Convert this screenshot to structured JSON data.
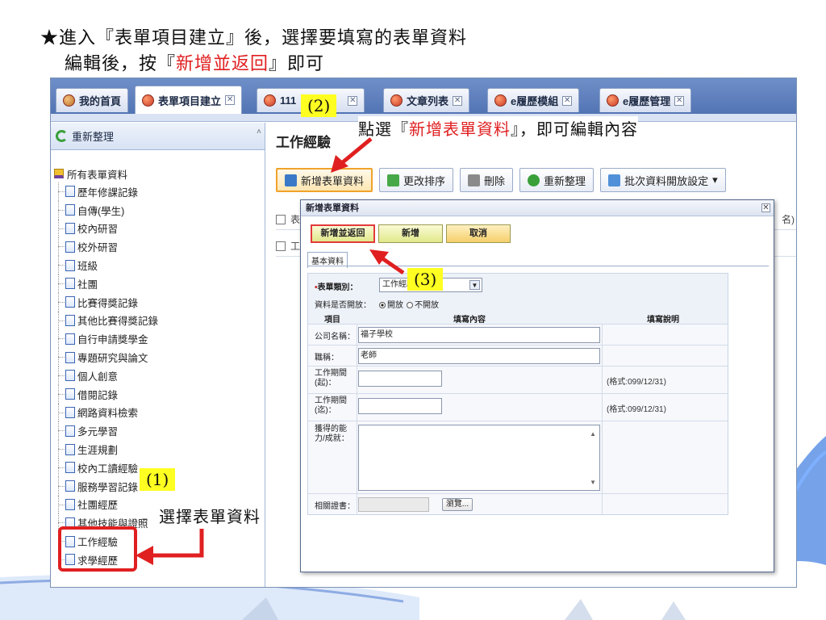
{
  "headline": {
    "line1": "★進入『表單項目建立』後，選擇要填寫的表單資料",
    "line2_prefix": "編輯後，按『",
    "line2_highlight": "新增並返回",
    "line2_suffix": "』即可"
  },
  "tabs": [
    {
      "label": "我的首頁",
      "icon": "home-icon",
      "closable": false
    },
    {
      "label": "表單項目建立",
      "icon": "app-icon",
      "closable": true
    },
    {
      "label": "111",
      "icon": "app-icon",
      "closable": true
    },
    {
      "label": "文章列表",
      "icon": "app-icon",
      "closable": true
    },
    {
      "label": "e履歷模組",
      "icon": "app-icon",
      "closable": true
    },
    {
      "label": "e履歷管理",
      "icon": "app-icon",
      "closable": true
    }
  ],
  "left_panel": {
    "refresh_label": "重新整理",
    "root_label": "所有表單資料",
    "items": [
      "歷年修課記錄",
      "自傳(學生)",
      "校內研習",
      "校外研習",
      "班級",
      "社團",
      "比賽得獎記錄",
      "其他比賽得獎記錄",
      "自行申請獎學金",
      "專題研究與論文",
      "個人創意",
      "借閱記錄",
      "網路資料檢索",
      "多元學習",
      "生涯規劃",
      "校內工讀經驗",
      "服務學習記錄",
      "社團經歷",
      "其他技能與證照",
      "工作經驗",
      "求學經歷"
    ]
  },
  "main": {
    "title": "工作經驗",
    "toolbar": {
      "add": "新增表單資料",
      "sort": "更改排序",
      "delete": "刪除",
      "refresh": "重新整理",
      "batch": "批次資料開放設定"
    },
    "grid_row1_prefix": "表",
    "grid_row1_suffix": "名)",
    "grid_row2_prefix": "工"
  },
  "dialog": {
    "title": "新增表單資料",
    "btn_add_return": "新增並返回",
    "btn_add": "新增",
    "btn_cancel": "取消",
    "tab_basic": "基本資料",
    "category_label": "表單類別：",
    "category_value": "工作經驗",
    "open_label": "資料是否開放：",
    "open_yes": "開放",
    "open_no": "不開放",
    "col_item": "項目",
    "col_content": "填寫內容",
    "col_desc": "填寫說明",
    "company_label": "公司名稱：",
    "company_value": "福子學校",
    "position_label": "職稱：",
    "position_value": "老師",
    "start_label": "工作期間(起)：",
    "end_label": "工作期間(迄)：",
    "date_hint": "(格式:099/12/31)",
    "ability_label": "獲得的能力/成就：",
    "cert_label": "相關證書：",
    "browse": "瀏覽..."
  },
  "annotations": {
    "step1": "(1)",
    "step2": "(2)",
    "step3": "(3)",
    "step1_text": "選擇表單資料",
    "step2_prefix": "點選『",
    "step2_highlight": "新增表單資料",
    "step2_suffix": "』，即可編輯內容"
  },
  "colors": {
    "accent_red": "#e02020",
    "callout_yellow": "#ffff22",
    "tab_bar": "#5a7cbb"
  }
}
